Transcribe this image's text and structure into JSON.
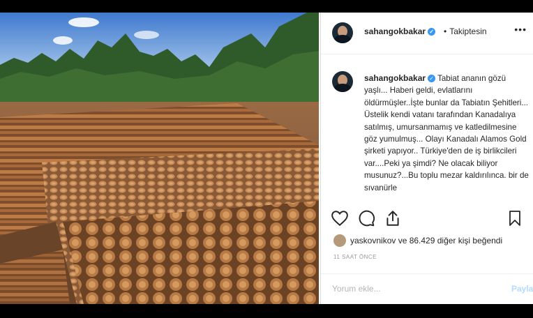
{
  "post": {
    "username": "sahangokbakar",
    "follow_dot": "•",
    "follow_label": "Takiptesin",
    "more_label": "•••",
    "caption": "Tabiat ananın gözü yaşlı... Haberi geldi, evlatlarını öldürmüşler..İşte bunlar da Tabiatın Şehitleri... Üstelik kendi vatanı tarafından Kanadalıya satılmış, umursanmamış ve katledilmesine göz yumulmuş... Olayı Kanadalı Alamos Gold şirketi yapıyor.. Türkiye'den de iş birlikcileri var....Peki ya şimdi? Ne olacak biliyor musunuz?...Bu toplu mezar kaldırılınca. bir de sıvanürle",
    "likes_text": "yaskovnikov ve 86.429 diğer kişi beğendi",
    "time_ago": "11 SAAT ÖNCE",
    "comment_placeholder": "Yorum ekle...",
    "post_label": "Paylaş"
  },
  "icons": {
    "verified": "verified-badge-icon",
    "like": "heart-icon",
    "comment": "comment-icon",
    "share": "share-icon",
    "save": "bookmark-icon",
    "more": "more-options-icon"
  },
  "colors": {
    "verified": "#3897f0",
    "post_button": "#b3dbff",
    "text": "#262626"
  }
}
